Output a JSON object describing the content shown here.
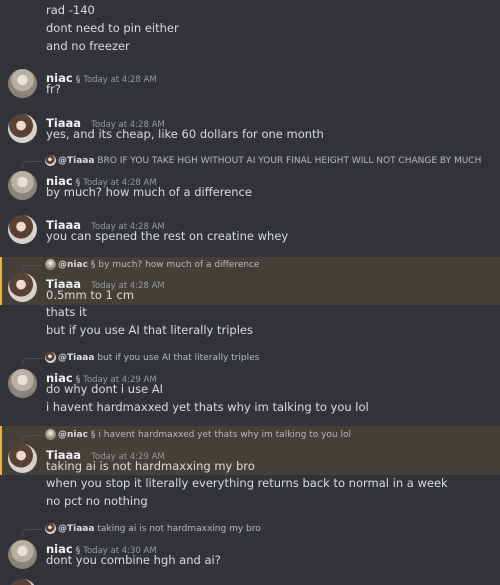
{
  "messages": {
    "m0": {
      "lines": [
        "rad -140",
        "dont need to pin either",
        "and no freezer"
      ]
    },
    "m1": {
      "author": "niac",
      "badge": "§",
      "time": "Today at 4:28 AM",
      "text": "fr?"
    },
    "m2": {
      "author": "Tiaaa",
      "time": "Today at 4:28 AM",
      "text": "yes, and its cheap, like 60 dollars for one month"
    },
    "m3": {
      "reply_author": "@Tiaaa",
      "reply_text": "BRO IF YOU TAKE HGH WITHOUT AI YOUR FINAL HEIGHT WILL NOT CHANGE BY MUCH",
      "author": "niac",
      "badge": "§",
      "time": "Today at 4:28 AM",
      "text": "by much? how much of a difference"
    },
    "m4": {
      "author": "Tiaaa",
      "time": "Today at 4:28 AM",
      "text": "you can spened the rest on creatine whey"
    },
    "m5": {
      "reply_author": "@niac",
      "reply_badge": "§",
      "reply_text": "by much? how much of a difference",
      "author": "Tiaaa",
      "time": "Today at 4:28 AM",
      "text": "0.5mm to 1 cm",
      "lines": [
        "thats it",
        "but if you use AI that literally triples"
      ]
    },
    "m6": {
      "reply_author": "@Tiaaa",
      "reply_text": "but if you use AI that literally triples",
      "author": "niac",
      "badge": "§",
      "time": "Today at 4:29 AM",
      "text": "do why dont i use AI",
      "lines": [
        "i havent hardmaxxed yet thats why im talking to you lol"
      ]
    },
    "m7": {
      "reply_author": "@niac",
      "reply_badge": "§",
      "reply_text": "i havent hardmaxxed yet thats why im talking to you lol",
      "author": "Tiaaa",
      "time": "Today at 4:29 AM",
      "text": "taking ai is not hardmaxxing my bro",
      "lines": [
        "when you stop it literally everything returns back to normal in a week",
        "no pct no nothing"
      ]
    },
    "m8": {
      "reply_author": "@Tiaaa",
      "reply_text": "taking ai is not hardmaxxing my bro",
      "author": "niac",
      "badge": "§",
      "time": "Today at 4:30 AM",
      "text": "dont you combine hgh and ai?"
    }
  }
}
